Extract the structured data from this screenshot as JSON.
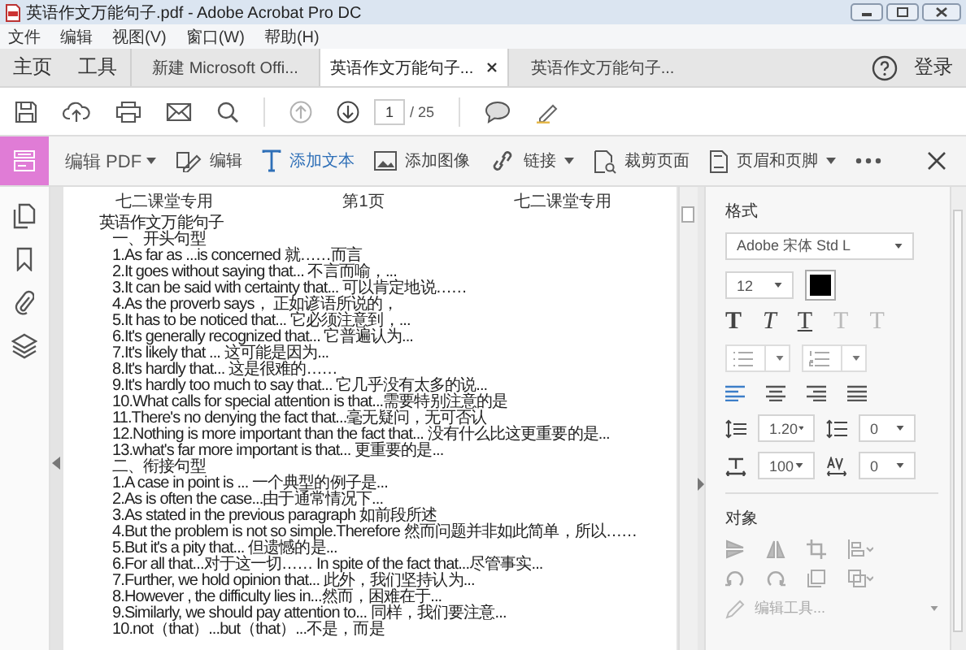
{
  "window": {
    "title": "英语作文万能句子.pdf - Adobe Acrobat Pro DC"
  },
  "menu": [
    "文件",
    "编辑",
    "视图(V)",
    "窗口(W)",
    "帮助(H)"
  ],
  "tab_bar": {
    "home": "主页",
    "tools": "工具",
    "tabs": [
      {
        "label": "新建 Microsoft Offi...",
        "selected": false
      },
      {
        "label": "英语作文万能句子...",
        "selected": true
      },
      {
        "label": "英语作文万能句子...",
        "selected": false
      }
    ],
    "login": "登录"
  },
  "toolbar": {
    "page_current": "1",
    "page_total": "/ 25",
    "prev_disabled": true
  },
  "edit_toolbar": {
    "title": "编辑 PDF",
    "tools": [
      {
        "kind": "edit",
        "label": "编辑",
        "selected": false,
        "dropdown": false
      },
      {
        "kind": "text",
        "label": "添加文本",
        "selected": true,
        "dropdown": false
      },
      {
        "kind": "image",
        "label": "添加图像",
        "selected": false,
        "dropdown": false
      },
      {
        "kind": "link",
        "label": "链接",
        "selected": false,
        "dropdown": true
      },
      {
        "kind": "crop",
        "label": "裁剪页面",
        "selected": false,
        "dropdown": false
      },
      {
        "kind": "header",
        "label": "页眉和页脚",
        "selected": false,
        "dropdown": true
      }
    ]
  },
  "document": {
    "header_left": "七二课堂专用",
    "header_center": "第1页",
    "header_right": "七二课堂专用",
    "lines": [
      {
        "kind": "title",
        "text": "英语作文万能句子"
      },
      {
        "kind": "section",
        "text": "一、开头句型"
      },
      {
        "kind": "item",
        "text": "1.As far as ...is concerned 就……而言"
      },
      {
        "kind": "item",
        "text": "2.It goes without saying that... 不言而喻，..."
      },
      {
        "kind": "item",
        "text": "3.It can be said with certainty that... 可以肯定地说……"
      },
      {
        "kind": "item",
        "text": "4.As the proverb says， 正如谚语所说的，"
      },
      {
        "kind": "item",
        "text": "5.It has to be noticed that... 它必须注意到，..."
      },
      {
        "kind": "item",
        "text": "6.It's generally recognized that... 它普遍认为..."
      },
      {
        "kind": "item",
        "text": "7.It's likely that ... 这可能是因为..."
      },
      {
        "kind": "item",
        "text": "8.It's hardly that... 这是很难的……"
      },
      {
        "kind": "item",
        "text": "9.It's hardly too much to say that... 它几乎没有太多的说..."
      },
      {
        "kind": "item",
        "text": "10.What calls for special attention is that...需要特别注意的是"
      },
      {
        "kind": "item",
        "text": "11.There's no denying the fact that...毫无疑问，无可否认"
      },
      {
        "kind": "item",
        "text": "12.Nothing is more important than the fact that... 没有什么比这更重要的是..."
      },
      {
        "kind": "item",
        "text": "13.what's far more important is that... 更重要的是..."
      },
      {
        "kind": "section",
        "text": "二、衔接句型"
      },
      {
        "kind": "item",
        "text": "1.A case in point is ... 一个典型的例子是..."
      },
      {
        "kind": "item",
        "text": "2.As is often the case...由于通常情况下..."
      },
      {
        "kind": "item",
        "text": "3.As stated in the previous paragraph 如前段所述"
      },
      {
        "kind": "item",
        "text": "4.But the problem is not so simple.Therefore 然而问题并非如此简单，所以……"
      },
      {
        "kind": "item",
        "text": "5.But it's a pity that... 但遗憾的是..."
      },
      {
        "kind": "item",
        "text": "6.For all that...对于这一切…… In spite of the fact that...尽管事实..."
      },
      {
        "kind": "item",
        "text": "7.Further, we hold opinion that... 此外，我们坚持认为..."
      },
      {
        "kind": "item",
        "text": "8.However , the difficulty lies in...然而，困难在于..."
      },
      {
        "kind": "item",
        "text": "9.Similarly, we should pay attention to... 同样，我们要注意..."
      },
      {
        "kind": "item",
        "text": "10.not（that）...but（that）...不是，而是"
      }
    ]
  },
  "format_panel": {
    "title": "格式",
    "font": "Adobe 宋体 Std L",
    "size": "12",
    "color": "#000000",
    "text_styles": [
      {
        "kind": "bold",
        "label": "T",
        "disabled": false
      },
      {
        "kind": "italic",
        "label": "T",
        "disabled": false
      },
      {
        "kind": "underline",
        "label": "T",
        "disabled": false
      },
      {
        "kind": "sup",
        "label": "T",
        "disabled": true
      },
      {
        "kind": "sub",
        "label": "T",
        "disabled": true
      }
    ],
    "alignments": [
      {
        "kind": "left",
        "selected": true
      },
      {
        "kind": "center",
        "selected": false
      },
      {
        "kind": "right",
        "selected": false
      },
      {
        "kind": "justify",
        "selected": false
      }
    ],
    "line_spacing": "1.20",
    "paragraph_spacing": "0",
    "scale": "100",
    "char_spacing": "0"
  },
  "objects_panel": {
    "title": "对象",
    "edit_tool": "编辑工具..."
  }
}
